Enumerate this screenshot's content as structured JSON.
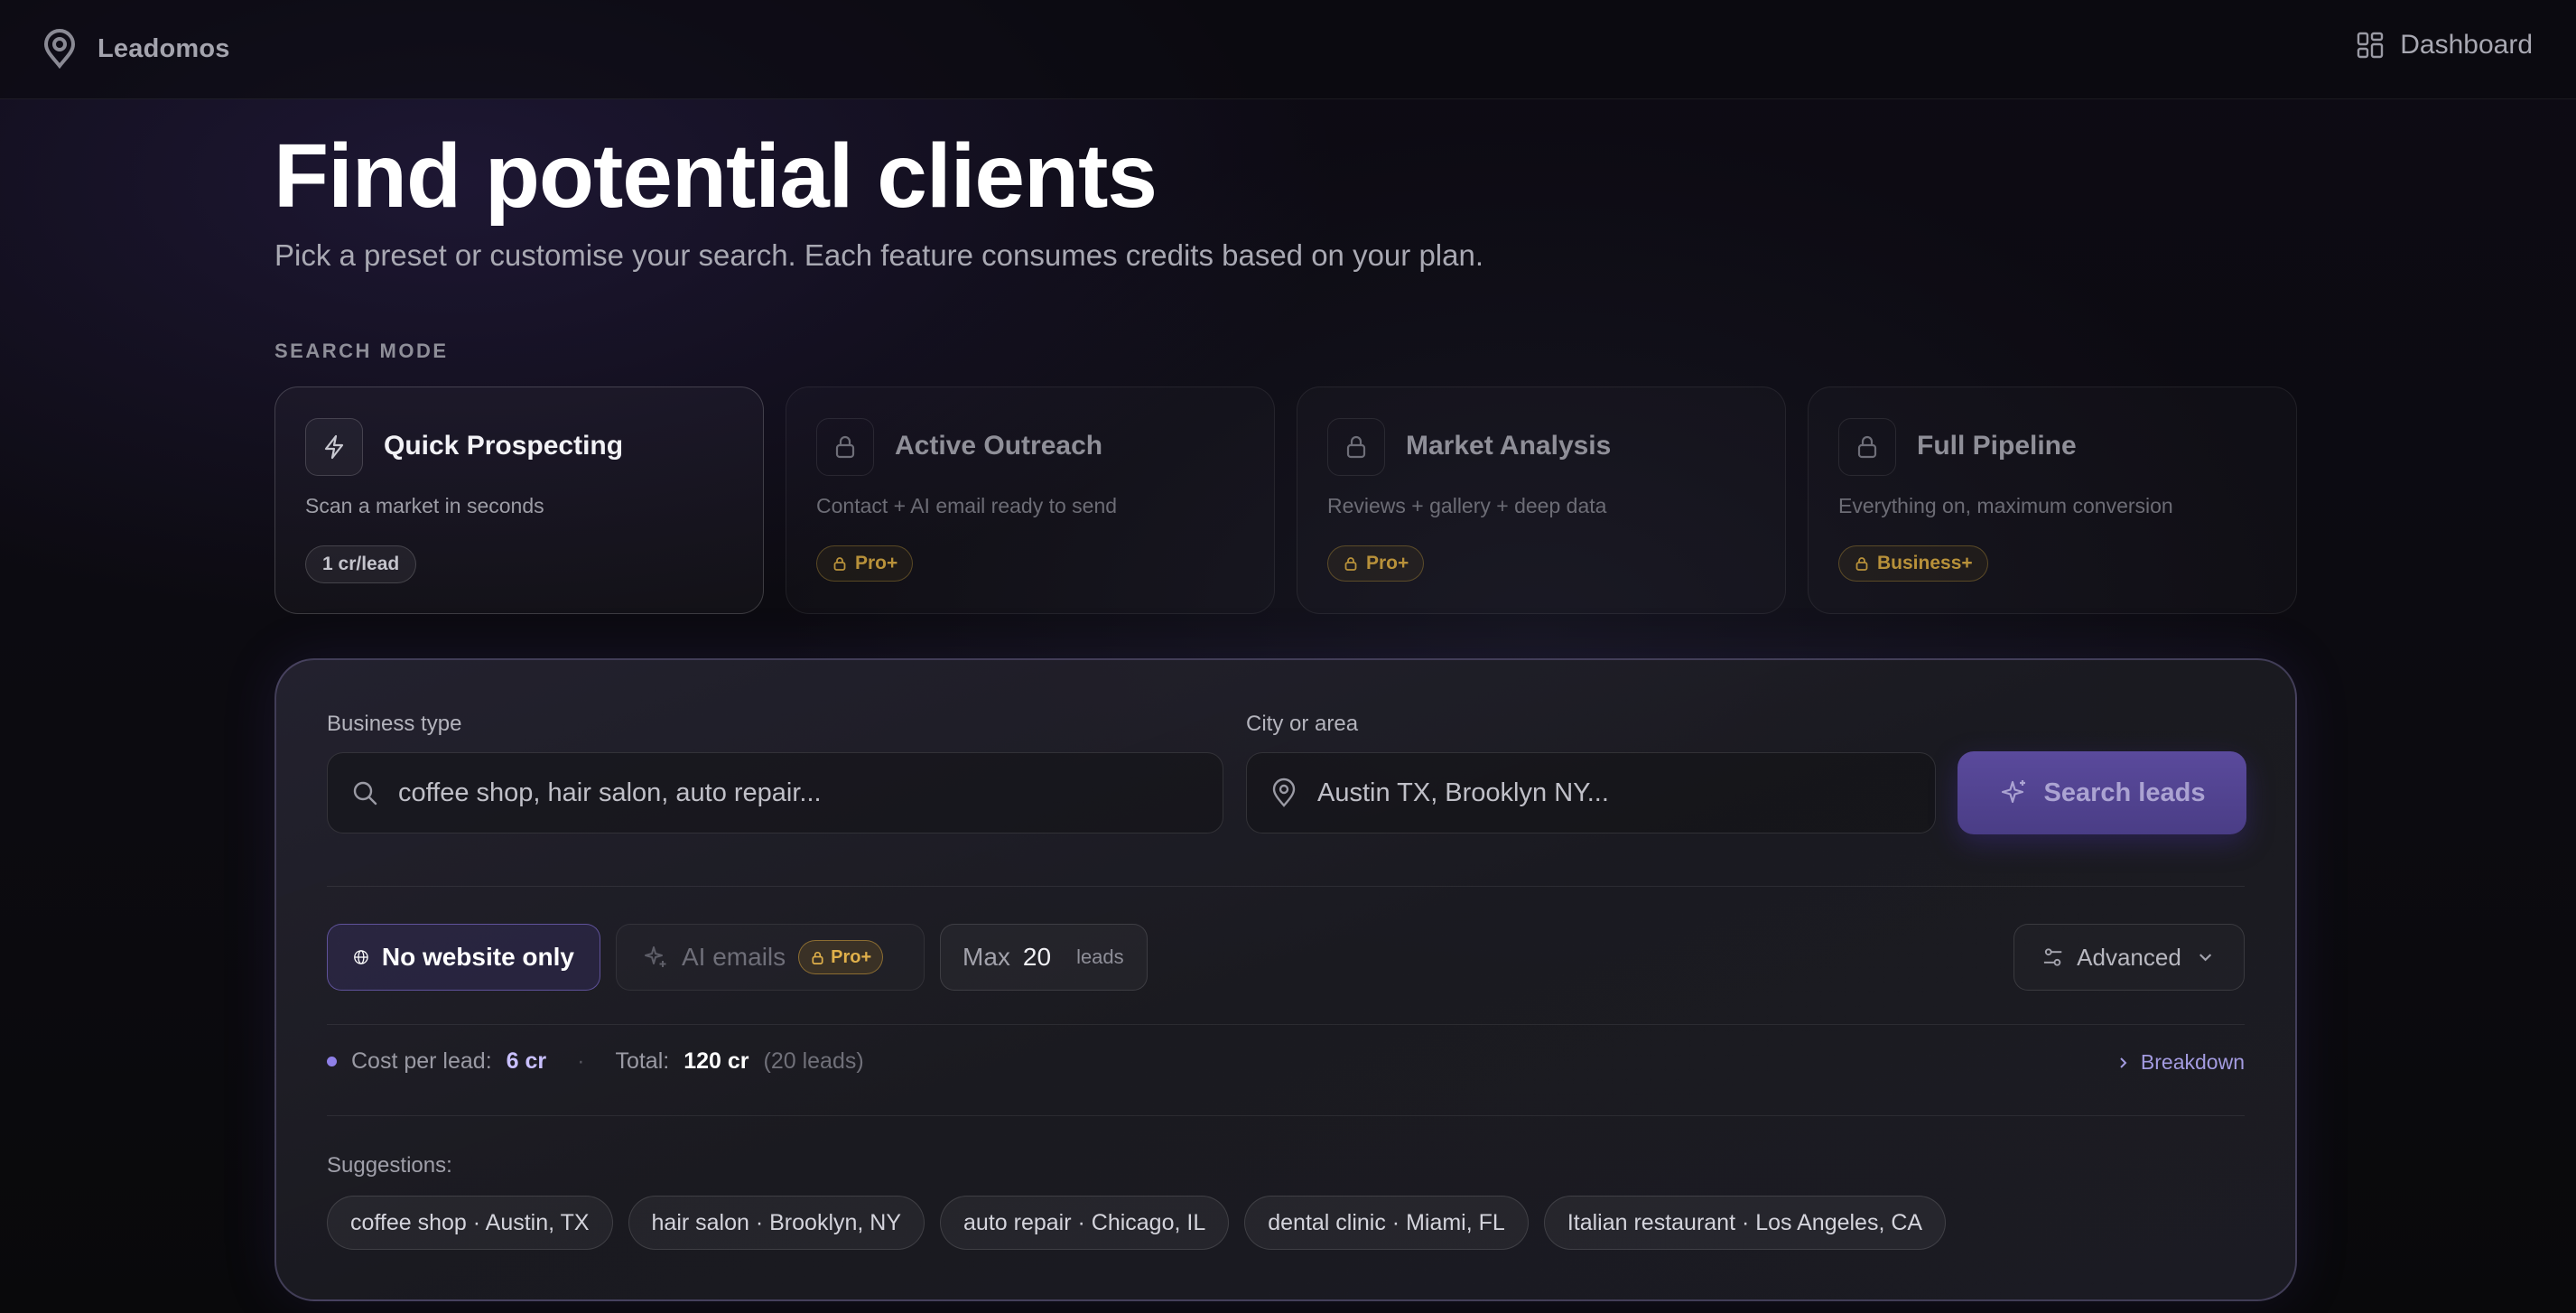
{
  "app": {
    "name": "Leadomos",
    "dashboard_label": "Dashboard"
  },
  "hero": {
    "title": "Find potential clients",
    "subtitle": "Pick a preset or customise your search. Each feature consumes credits based on your plan."
  },
  "search_mode": {
    "label": "SEARCH MODE",
    "modes": [
      {
        "title": "Quick Prospecting",
        "description": "Scan a market in seconds",
        "badge": "1 cr/lead",
        "icon": "bolt-icon",
        "locked": false
      },
      {
        "title": "Active Outreach",
        "description": "Contact + AI email ready to send",
        "badge": "Pro+",
        "icon": "lock-icon",
        "locked": true
      },
      {
        "title": "Market Analysis",
        "description": "Reviews + gallery + deep data",
        "badge": "Pro+",
        "icon": "lock-icon",
        "locked": true
      },
      {
        "title": "Full Pipeline",
        "description": "Everything on, maximum conversion",
        "badge": "Business+",
        "icon": "lock-icon",
        "locked": true
      }
    ]
  },
  "search": {
    "business_type": {
      "label": "Business type",
      "placeholder": "coffee shop, hair salon, auto repair...",
      "value": ""
    },
    "city": {
      "label": "City or area",
      "placeholder": "Austin TX, Brooklyn NY...",
      "value": ""
    },
    "button_label": "Search leads"
  },
  "filters": {
    "no_website": "No website only",
    "ai_emails": "AI emails",
    "ai_emails_badge": "Pro+",
    "max_label": "Max",
    "max_value": "20",
    "max_unit": "leads",
    "advanced": "Advanced"
  },
  "cost": {
    "per_lead_label": "Cost per lead:",
    "per_lead_value": "6 cr",
    "separator": "·",
    "total_label": "Total:",
    "total_value": "120 cr",
    "total_note": "(20 leads)",
    "breakdown": "Breakdown"
  },
  "suggestions": {
    "label": "Suggestions:",
    "items": [
      "coffee shop · Austin, TX",
      "hair salon · Brooklyn, NY",
      "auto repair · Chicago, IL",
      "dental clinic · Miami, FL",
      "Italian restaurant · Los Angeles, CA"
    ]
  },
  "colors": {
    "accent": "#5a4a9c",
    "accent_light": "#c9c0ff",
    "gold": "#e0b04a",
    "background": "#0c0b10"
  }
}
